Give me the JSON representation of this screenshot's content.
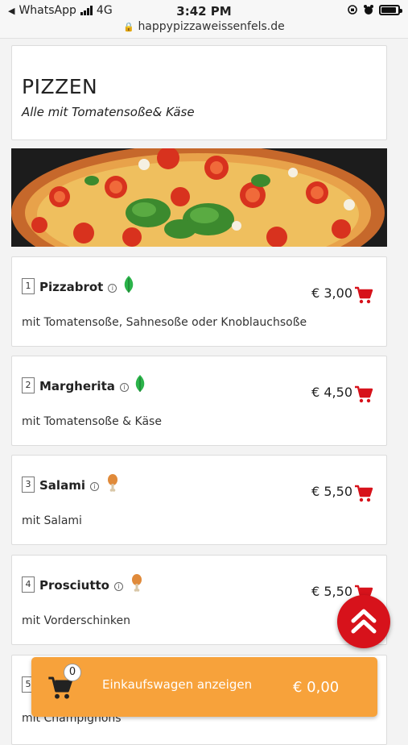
{
  "status_bar": {
    "back_app": "WhatsApp",
    "network": "4G",
    "time": "3:42 PM",
    "url": "happypizzaweissenfels.de"
  },
  "section": {
    "title": "PIZZEN",
    "subtitle": "Alle mit Tomatensoße& Käse"
  },
  "items": [
    {
      "number": "1",
      "name": "Pizzabrot",
      "diet_icon": "leaf-icon",
      "description": "mit Tomatensoße, Sahnesoße oder Knoblauchsoße",
      "price": "€ 3,00"
    },
    {
      "number": "2",
      "name": "Margherita",
      "diet_icon": "leaf-icon",
      "description": "mit Tomatensoße & Käse",
      "price": "€ 4,50"
    },
    {
      "number": "3",
      "name": "Salami",
      "diet_icon": "drumstick-icon",
      "description": "mit Salami",
      "price": "€ 5,50"
    },
    {
      "number": "4",
      "name": "Prosciutto",
      "diet_icon": "drumstick-icon",
      "description": "mit Vorderschinken",
      "price": "€ 5,50"
    },
    {
      "number": "5",
      "name": "",
      "diet_icon": "",
      "description": "mit Champignons",
      "price": ""
    }
  ],
  "cart": {
    "count": "0",
    "label": "Einkaufswagen anzeigen",
    "total": "€ 0,00"
  },
  "colors": {
    "accent_red": "#d7121b",
    "cart_orange": "#f7a23b",
    "veg_green": "#2bb34a",
    "meat_orange": "#e08a3a"
  }
}
